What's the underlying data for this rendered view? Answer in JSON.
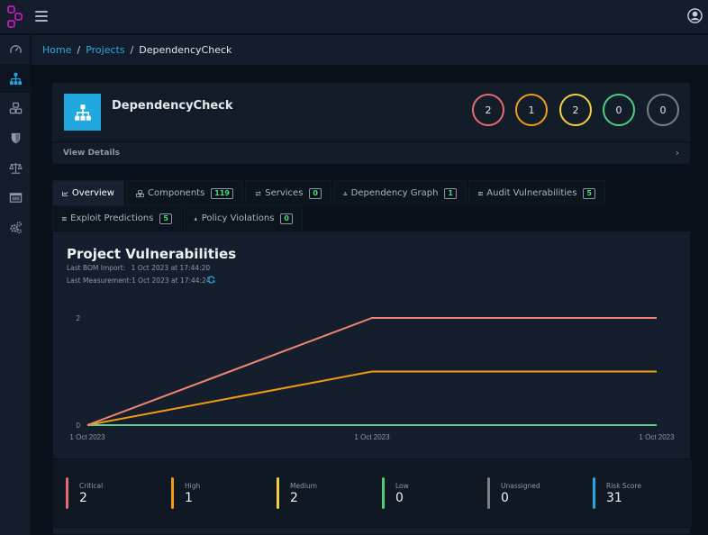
{
  "header": {
    "logo_icon": "dependency-track-logo",
    "menu_icon": "hamburger-icon",
    "user_icon": "user-circle-icon"
  },
  "sidebar": {
    "items": [
      {
        "name": "dashboard",
        "icon": "speedometer-icon",
        "active": false
      },
      {
        "name": "projects",
        "icon": "sitemap-icon",
        "active": true
      },
      {
        "name": "components",
        "icon": "cubes-icon",
        "active": false
      },
      {
        "name": "vulnerabilities",
        "icon": "shield-icon",
        "active": false
      },
      {
        "name": "licenses",
        "icon": "balance-scale-icon",
        "active": false
      },
      {
        "name": "tags",
        "icon": "window-icon",
        "active": false
      },
      {
        "name": "administration",
        "icon": "cogs-icon",
        "active": false
      }
    ]
  },
  "breadcrumb": {
    "home": "Home",
    "projects": "Projects",
    "sep": "/",
    "current": "DependencyCheck"
  },
  "project": {
    "name": "DependencyCheck",
    "view_details": "View Details",
    "chevron": "›",
    "severity_counts": [
      {
        "name": "critical",
        "value": "2",
        "color": "#e86a6e"
      },
      {
        "name": "high",
        "value": "1",
        "color": "#f39c12"
      },
      {
        "name": "medium",
        "value": "2",
        "color": "#f4d03f"
      },
      {
        "name": "low",
        "value": "0",
        "color": "#4ccf7a"
      },
      {
        "name": "unassigned",
        "value": "0",
        "color": "#7a7f85"
      }
    ]
  },
  "tabs": [
    {
      "label": "Overview",
      "icon": "line-chart-icon",
      "badge": null,
      "active": true
    },
    {
      "label": "Components",
      "icon": "cubes-icon",
      "badge": "119",
      "active": false
    },
    {
      "label": "Services",
      "icon": "exchange-icon",
      "badge": "0",
      "active": false
    },
    {
      "label": "Dependency Graph",
      "icon": "sitemap-icon",
      "badge": "1",
      "active": false
    },
    {
      "label": "Audit Vulnerabilities",
      "icon": "tasks-icon",
      "badge": "5",
      "active": false
    },
    {
      "label": "Exploit Predictions",
      "icon": "tasks-icon",
      "badge": "5",
      "active": false
    },
    {
      "label": "Policy Violations",
      "icon": "fire-icon",
      "badge": "0",
      "active": false
    }
  ],
  "overview": {
    "title": "Project Vulnerabilities",
    "last_bom_import_label": "Last BOM Import:",
    "last_bom_import_value": "1 Oct 2023 at 17:44:20",
    "last_measurement_label": "Last Measurement:",
    "last_measurement_value": "1 Oct 2023 at 17:44:24",
    "refresh_icon": "refresh-icon"
  },
  "chart_data": {
    "type": "line",
    "title": "",
    "xlabel": "",
    "ylabel": "",
    "x": [
      "1 Oct 2023",
      "1 Oct 2023",
      "1 Oct 2023"
    ],
    "x_tick_labels": [
      "1 Oct 2023",
      "1 Oct 2023",
      "1 Oct 2023"
    ],
    "y_tick_labels": [
      "0",
      "2"
    ],
    "ylim": [
      0,
      2
    ],
    "grid": false,
    "legend": "none",
    "series": [
      {
        "name": "Critical",
        "color": "#f08377",
        "values": [
          0,
          2,
          2
        ]
      },
      {
        "name": "High",
        "color": "#f39c12",
        "values": [
          0,
          1,
          1
        ]
      },
      {
        "name": "Low",
        "color": "#5ccf95",
        "values": [
          0,
          0,
          0
        ]
      }
    ]
  },
  "stats": [
    {
      "label": "Critical",
      "value": "2",
      "color": "#e86a6e"
    },
    {
      "label": "High",
      "value": "1",
      "color": "#f39c12"
    },
    {
      "label": "Medium",
      "value": "2",
      "color": "#f4d03f"
    },
    {
      "label": "Low",
      "value": "0",
      "color": "#4ccf7a"
    },
    {
      "label": "Unassigned",
      "value": "0",
      "color": "#7a7f85"
    },
    {
      "label": "Risk Score",
      "value": "31",
      "color": "#20a8df"
    }
  ]
}
